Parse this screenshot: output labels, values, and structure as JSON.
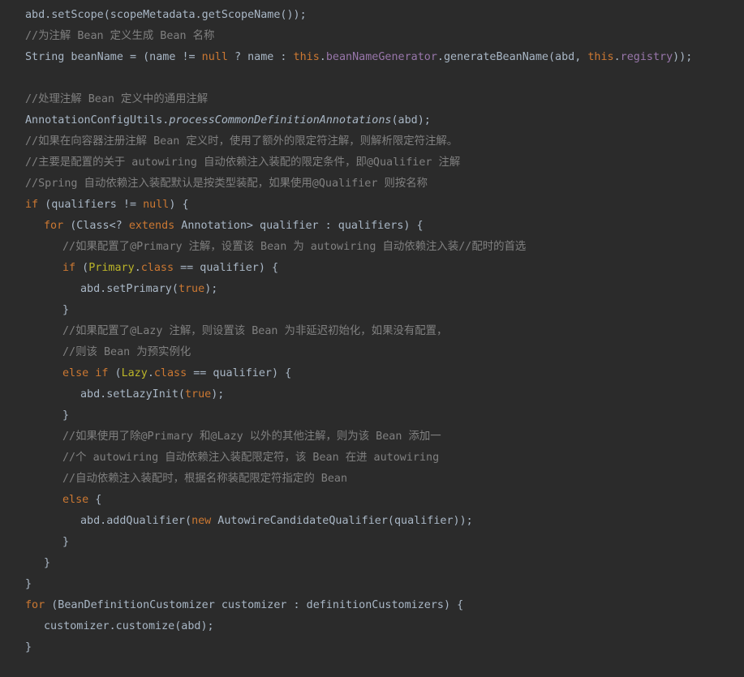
{
  "colors": {
    "background": "#2b2b2b",
    "plain": "#a9b7c6",
    "keyword": "#cc7832",
    "comment": "#808080",
    "field": "#9876aa",
    "annotation": "#bbb529"
  },
  "code": [
    {
      "indent": 0,
      "tokens": [
        {
          "t": "abd.setScope(scopeMetadata.getScopeName());",
          "c": "plain"
        }
      ]
    },
    {
      "indent": 0,
      "tokens": [
        {
          "t": "//为注解 Bean 定义生成 Bean 名称",
          "c": "cm"
        }
      ]
    },
    {
      "indent": 0,
      "tokens": [
        {
          "t": "String beanName = (name != ",
          "c": "plain"
        },
        {
          "t": "null",
          "c": "kw"
        },
        {
          "t": " ? name : ",
          "c": "plain"
        },
        {
          "t": "this",
          "c": "kw"
        },
        {
          "t": ".",
          "c": "plain"
        },
        {
          "t": "beanNameGenerator",
          "c": "field"
        },
        {
          "t": ".generateBeanName(abd, ",
          "c": "plain"
        },
        {
          "t": "this",
          "c": "kw"
        },
        {
          "t": ".",
          "c": "plain"
        },
        {
          "t": "registry",
          "c": "field"
        },
        {
          "t": "));",
          "c": "plain"
        }
      ]
    },
    {
      "indent": 0,
      "tokens": []
    },
    {
      "indent": 0,
      "tokens": [
        {
          "t": "//处理注解 Bean 定义中的通用注解",
          "c": "cm"
        }
      ]
    },
    {
      "indent": 0,
      "tokens": [
        {
          "t": "AnnotationConfigUtils.",
          "c": "plain"
        },
        {
          "t": "processCommonDefinitionAnnotations",
          "c": "ital"
        },
        {
          "t": "(abd);",
          "c": "plain"
        }
      ]
    },
    {
      "indent": 0,
      "tokens": [
        {
          "t": "//如果在向容器注册注解 Bean 定义时，使用了额外的限定符注解，则解析限定符注解。",
          "c": "cm"
        }
      ]
    },
    {
      "indent": 0,
      "tokens": [
        {
          "t": "//主要是配置的关于 autowiring 自动依赖注入装配的限定条件，即@Qualifier 注解",
          "c": "cm"
        }
      ]
    },
    {
      "indent": 0,
      "tokens": [
        {
          "t": "//Spring 自动依赖注入装配默认是按类型装配，如果使用@Qualifier 则按名称",
          "c": "cm"
        }
      ]
    },
    {
      "indent": 0,
      "tokens": [
        {
          "t": "if",
          "c": "kw"
        },
        {
          "t": " (qualifiers != ",
          "c": "plain"
        },
        {
          "t": "null",
          "c": "kw"
        },
        {
          "t": ") {",
          "c": "plain"
        }
      ]
    },
    {
      "indent": 1,
      "tokens": [
        {
          "t": "for",
          "c": "kw"
        },
        {
          "t": " (Class<? ",
          "c": "plain"
        },
        {
          "t": "extends",
          "c": "kw"
        },
        {
          "t": " Annotation> qualifier : qualifiers) {",
          "c": "plain"
        }
      ]
    },
    {
      "indent": 2,
      "tokens": [
        {
          "t": "//如果配置了@Primary 注解，设置该 Bean 为 autowiring 自动依赖注入装//配时的首选",
          "c": "cm"
        }
      ]
    },
    {
      "indent": 2,
      "tokens": [
        {
          "t": "if",
          "c": "kw"
        },
        {
          "t": " (",
          "c": "plain"
        },
        {
          "t": "Primary",
          "c": "ann"
        },
        {
          "t": ".",
          "c": "plain"
        },
        {
          "t": "class",
          "c": "kw"
        },
        {
          "t": " == qualifier) {",
          "c": "plain"
        }
      ]
    },
    {
      "indent": 3,
      "tokens": [
        {
          "t": "abd.setPrimary(",
          "c": "plain"
        },
        {
          "t": "true",
          "c": "kw"
        },
        {
          "t": ");",
          "c": "plain"
        }
      ]
    },
    {
      "indent": 2,
      "tokens": [
        {
          "t": "}",
          "c": "plain"
        }
      ]
    },
    {
      "indent": 2,
      "tokens": [
        {
          "t": "//如果配置了@Lazy 注解，则设置该 Bean 为非延迟初始化，如果没有配置，",
          "c": "cm"
        }
      ]
    },
    {
      "indent": 2,
      "tokens": [
        {
          "t": "//则该 Bean 为预实例化",
          "c": "cm"
        }
      ]
    },
    {
      "indent": 2,
      "tokens": [
        {
          "t": "else if",
          "c": "kw"
        },
        {
          "t": " (",
          "c": "plain"
        },
        {
          "t": "Lazy",
          "c": "ann"
        },
        {
          "t": ".",
          "c": "plain"
        },
        {
          "t": "class",
          "c": "kw"
        },
        {
          "t": " == qualifier) {",
          "c": "plain"
        }
      ]
    },
    {
      "indent": 3,
      "tokens": [
        {
          "t": "abd.setLazyInit(",
          "c": "plain"
        },
        {
          "t": "true",
          "c": "kw"
        },
        {
          "t": ");",
          "c": "plain"
        }
      ]
    },
    {
      "indent": 2,
      "tokens": [
        {
          "t": "}",
          "c": "plain"
        }
      ]
    },
    {
      "indent": 2,
      "tokens": [
        {
          "t": "//如果使用了除@Primary 和@Lazy 以外的其他注解，则为该 Bean 添加一",
          "c": "cm"
        }
      ]
    },
    {
      "indent": 2,
      "tokens": [
        {
          "t": "//个 autowiring 自动依赖注入装配限定符，该 Bean 在进 autowiring",
          "c": "cm"
        }
      ]
    },
    {
      "indent": 2,
      "tokens": [
        {
          "t": "//自动依赖注入装配时，根据名称装配限定符指定的 Bean",
          "c": "cm"
        }
      ]
    },
    {
      "indent": 2,
      "tokens": [
        {
          "t": "else",
          "c": "kw"
        },
        {
          "t": " {",
          "c": "plain"
        }
      ]
    },
    {
      "indent": 3,
      "tokens": [
        {
          "t": "abd.addQualifier(",
          "c": "plain"
        },
        {
          "t": "new",
          "c": "kw"
        },
        {
          "t": " AutowireCandidateQualifier(qualifier));",
          "c": "plain"
        }
      ]
    },
    {
      "indent": 2,
      "tokens": [
        {
          "t": "}",
          "c": "plain"
        }
      ]
    },
    {
      "indent": 1,
      "tokens": [
        {
          "t": "}",
          "c": "plain"
        }
      ]
    },
    {
      "indent": 0,
      "tokens": [
        {
          "t": "}",
          "c": "plain"
        }
      ]
    },
    {
      "indent": 0,
      "tokens": [
        {
          "t": "for",
          "c": "kw"
        },
        {
          "t": " (BeanDefinitionCustomizer customizer : definitionCustomizers) {",
          "c": "plain"
        }
      ]
    },
    {
      "indent": 1,
      "tokens": [
        {
          "t": "customizer.customize(abd);",
          "c": "plain"
        }
      ]
    },
    {
      "indent": 0,
      "tokens": [
        {
          "t": "}",
          "c": "plain"
        }
      ]
    }
  ]
}
